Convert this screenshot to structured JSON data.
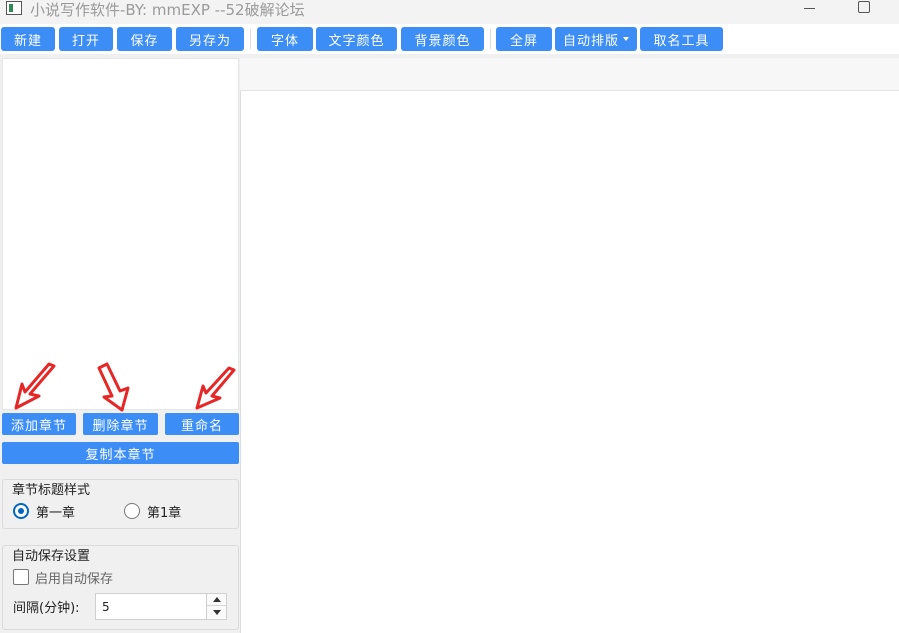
{
  "window": {
    "title": "小说写作软件-BY: mmEXP --52破解论坛"
  },
  "toolbar": {
    "new": "新建",
    "open": "打开",
    "save": "保存",
    "save_as": "另存为",
    "font": "字体",
    "text_color": "文字颜色",
    "bg_color": "背景颜色",
    "fullscreen": "全屏",
    "auto_layout": "自动排版",
    "naming_tool": "取名工具"
  },
  "chapters": {
    "add": "添加章节",
    "delete": "删除章节",
    "rename": "重命名",
    "copy": "复制本章节"
  },
  "title_style": {
    "group_label": "章节标题样式",
    "option_1": "第一章",
    "option_2": "第1章",
    "selected": "第一章"
  },
  "autosave": {
    "group_label": "自动保存设置",
    "enable_label": "启用自动保存",
    "enabled": false,
    "interval_label": "间隔(分钟):",
    "interval_value": "5"
  },
  "colors": {
    "accent": "#3c8ef6",
    "annotation": "#e52727",
    "radio": "#0067c0"
  }
}
